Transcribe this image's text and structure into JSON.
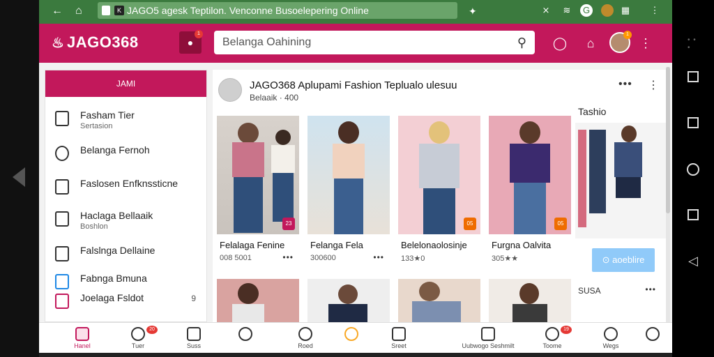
{
  "browser": {
    "url": "JAGO5 agesk Teptilon. Venconne Busoelepering Online",
    "tab_letter": "K"
  },
  "header": {
    "brand": "JAGO368",
    "notif_count": "1",
    "search_placeholder": "Belanga Oahining",
    "avatar_badge": "1"
  },
  "sidebar": {
    "top_label": "JAMI",
    "items": [
      {
        "title": "Fasham Tier",
        "sub": "Sertasion",
        "icon": "bag-icon",
        "trail": ""
      },
      {
        "title": "Belanga Fernoh",
        "sub": "",
        "icon": "heart-circle-icon",
        "trail": ""
      },
      {
        "title": "Faslosen Enfknssticne",
        "sub": "",
        "icon": "list-icon",
        "trail": ""
      },
      {
        "title": "Haclaga Bellaaik",
        "sub": "Boshlon",
        "icon": "tag-icon",
        "trail": ""
      },
      {
        "title": "Falslnga Dellaine",
        "sub": "",
        "icon": "clipboard-icon",
        "trail": ""
      },
      {
        "title": "Fabnga Bmuna",
        "sub": "",
        "icon": "book-icon",
        "trail": ""
      },
      {
        "title": "Joelaga Fsldot",
        "sub": "",
        "icon": "instagram-icon",
        "trail": "9"
      }
    ]
  },
  "post": {
    "title": "JAGO368 Aplupami Fashion Teplualo ulesuu",
    "sub": "Belaaik · 400"
  },
  "products": [
    {
      "name": "Felalaga Fenine",
      "price": "008 5001",
      "badge": "23",
      "badge_color": "#c2185b"
    },
    {
      "name": "Felanga Fela",
      "price": "300600",
      "badge": "",
      "badge_color": ""
    },
    {
      "name": "Belelonaolosinje",
      "price": "133★0",
      "badge": "05",
      "badge_color": "#ef6c00"
    },
    {
      "name": "Furgna Oalvita",
      "price": "305★★",
      "badge": "05",
      "badge_color": "#ef6c00"
    }
  ],
  "side_panel": {
    "title": "Tashio",
    "button": "aoeblire",
    "label": "SUSA"
  },
  "bottom_nav": [
    {
      "label": "Hanel",
      "icon": "home-icon"
    },
    {
      "label": "Tuer",
      "icon": "clock-icon",
      "badge": "20"
    },
    {
      "label": "Suss",
      "icon": "store-icon"
    },
    {
      "label": "",
      "icon": "watch-icon"
    },
    {
      "label": "Roed",
      "icon": "search-icon"
    },
    {
      "label": "",
      "icon": "reward-icon"
    },
    {
      "label": "Sreet",
      "icon": "calendar-icon"
    },
    {
      "label": "Uubwogo Seshmilt",
      "icon": "document-icon"
    },
    {
      "label": "Toome",
      "icon": "bell-icon",
      "badge": "19"
    },
    {
      "label": "Wegs",
      "icon": "user-icon"
    },
    {
      "label": "",
      "icon": "chat-icon"
    }
  ],
  "colors": {
    "brand": "#c2185b",
    "browser_bar": "#3b7a3e",
    "accent_blue": "#90caf9"
  }
}
